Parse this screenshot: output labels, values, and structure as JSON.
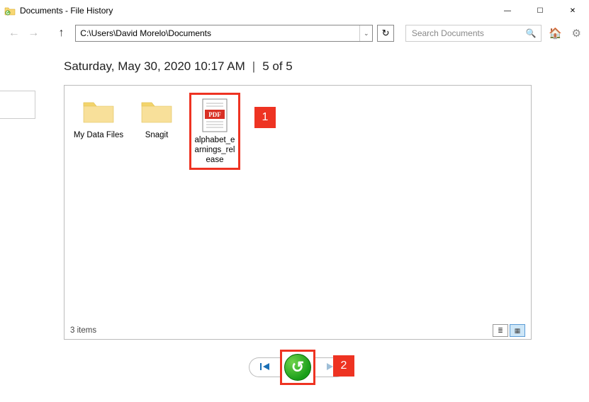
{
  "window": {
    "title": "Documents - File History"
  },
  "toolbar": {
    "address": "C:\\Users\\David Morelo\\Documents",
    "search_placeholder": "Search Documents"
  },
  "header": {
    "timestamp": "Saturday, May 30, 2020 10:17 AM",
    "position": "5 of 5"
  },
  "items": [
    {
      "type": "folder",
      "label": "My Data Files"
    },
    {
      "type": "folder",
      "label": "Snagit"
    },
    {
      "type": "pdf",
      "label": "alphabet_earnings_release",
      "highlighted": true
    }
  ],
  "status": {
    "count_label": "3 items"
  },
  "annotations": {
    "file": "1",
    "restore": "2"
  },
  "icons": {
    "back": "←",
    "forward": "→",
    "up": "↑",
    "dropdown": "⌄",
    "refresh": "↻",
    "search": "🔍",
    "home": "🏠",
    "settings": "⚙",
    "restore": "↺",
    "minimize": "—",
    "maximize": "☐",
    "close": "✕",
    "details_view": "≣",
    "icons_view": "▦",
    "skip_prev": "⏮",
    "skip_next": "⏭"
  }
}
